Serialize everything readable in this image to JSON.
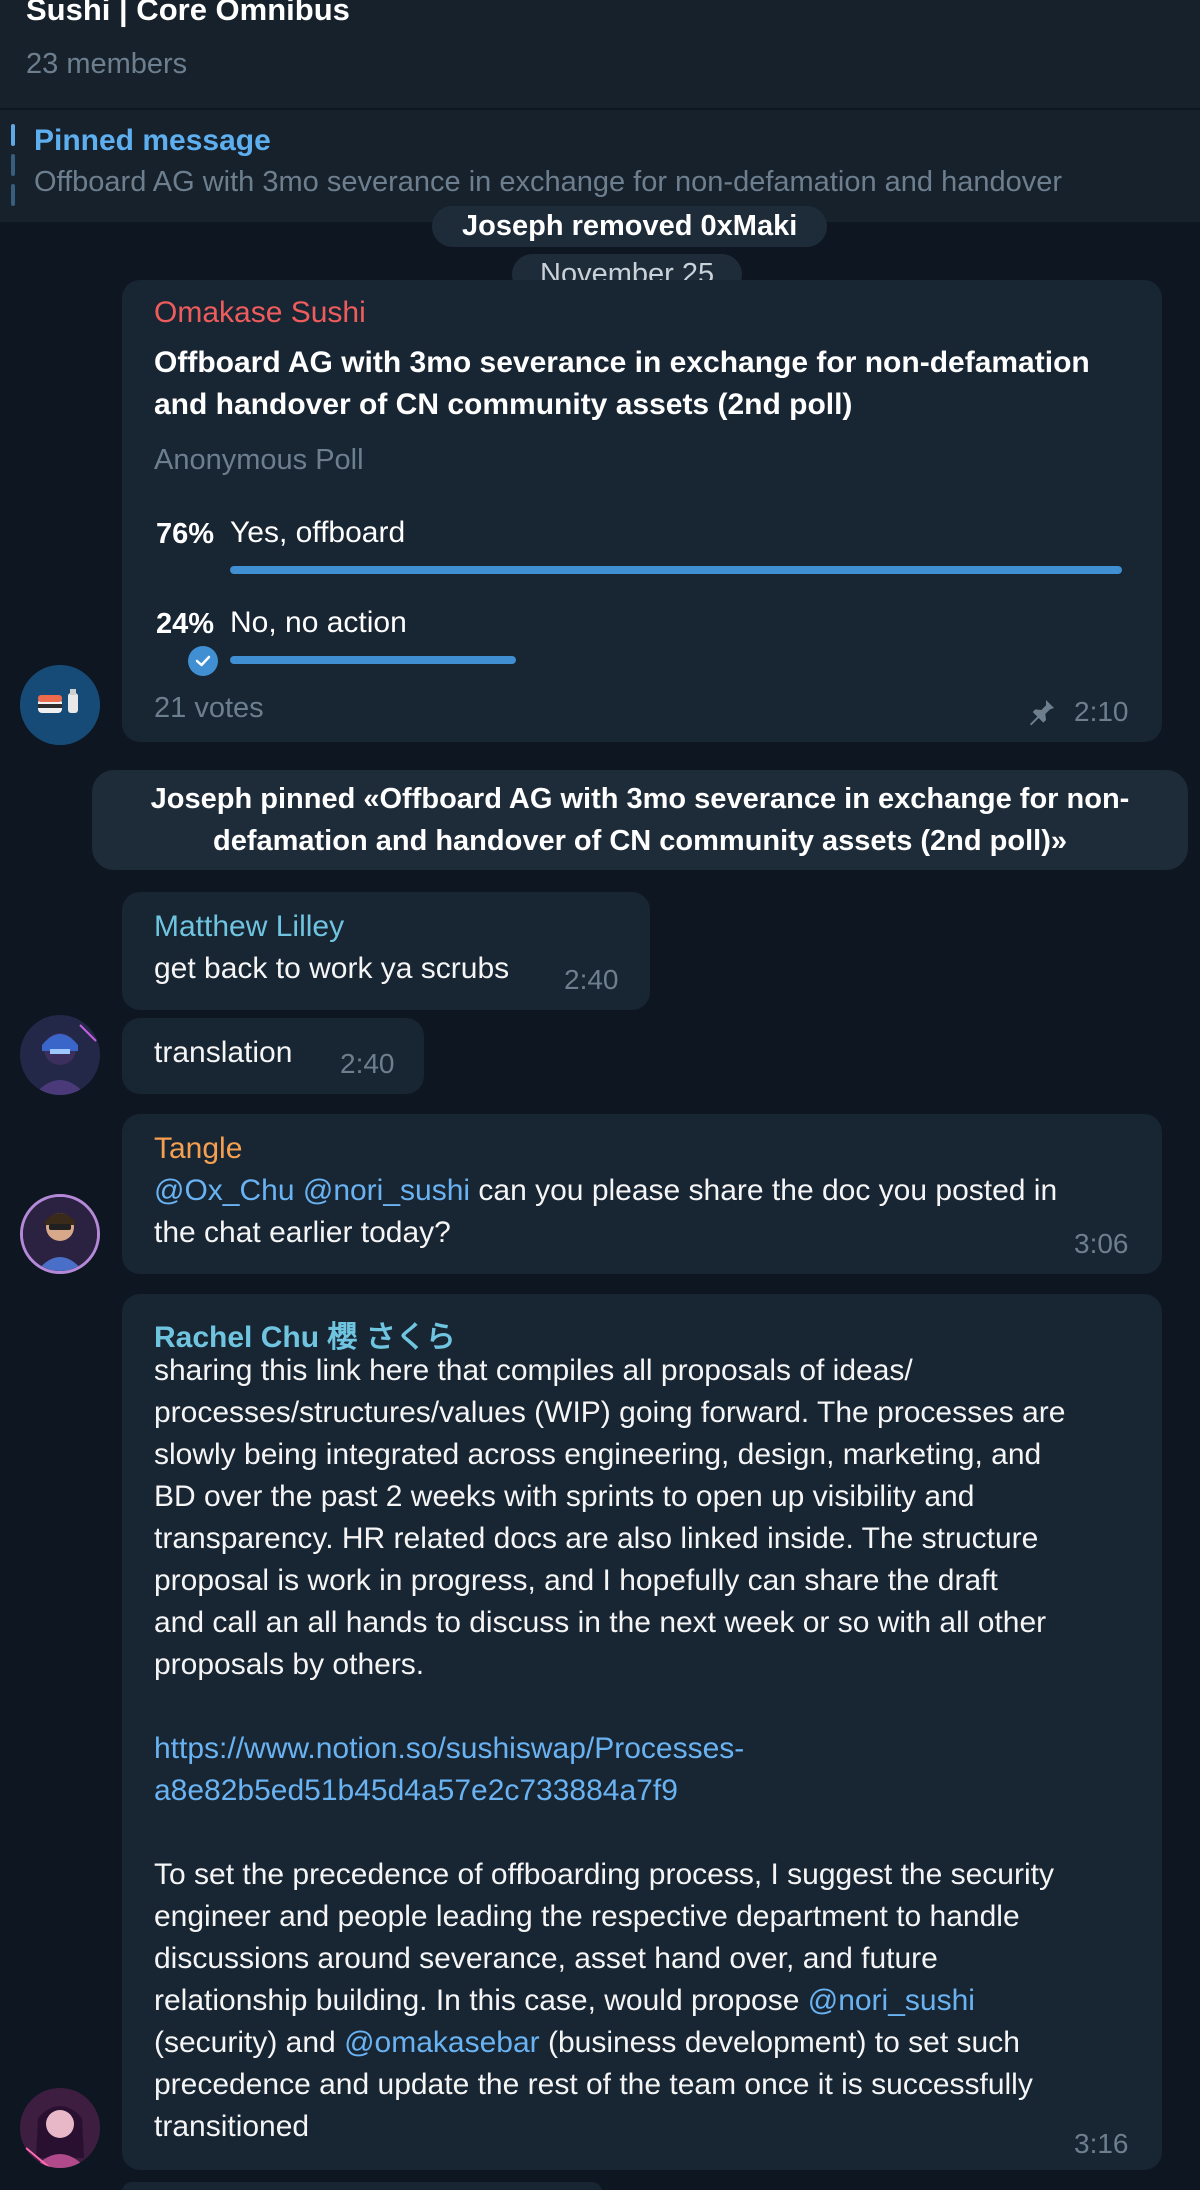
{
  "header": {
    "title": "Sushi | Core Omnibus",
    "members": "23 members"
  },
  "pinned": {
    "title": "Pinned message",
    "text": "Offboard AG with 3mo severance in exchange for non-defamation and handover"
  },
  "service_removed": "Joseph removed 0xMaki",
  "date_separator": "November 25",
  "poll_message": {
    "sender": "Omakase Sushi",
    "question_line1": "Offboard AG with 3mo severance in exchange for non-defamation",
    "question_line2": "and handover of CN community assets (2nd poll)",
    "poll_type": "Anonymous Poll",
    "options": [
      {
        "percent": "76%",
        "label": "Yes, offboard",
        "fraction": 0.76
      },
      {
        "percent": "24%",
        "label": "No, no action",
        "fraction": 0.24
      }
    ],
    "votes": "21 votes",
    "time": "2:10"
  },
  "service_pinned": {
    "line1": "Joseph pinned «Offboard AG with 3mo severance in exchange for non-",
    "line2": "defamation and handover of CN community assets (2nd poll)»"
  },
  "messages": [
    {
      "sender": "Matthew Lilley",
      "text": "get back to work ya scrubs",
      "time": "2:40"
    },
    {
      "text": "translation",
      "time": "2:40"
    },
    {
      "sender": "Tangle",
      "mention1": "@Ox_Chu",
      "mention2": "@nori_sushi",
      "text_line1": "can you please share the doc you posted in",
      "text_line2": "the chat earlier today?",
      "time": "3:06"
    }
  ],
  "rachel": {
    "sender": "Rachel Chu 櫻 さくら",
    "para1": [
      "sharing this link here that compiles all proposals of ideas/",
      "processes/structures/values (WIP) going forward. The processes are",
      "slowly being integrated across engineering, design, marketing, and",
      "BD over the past 2 weeks with sprints to open up visibility and",
      "transparency. HR related docs are also linked inside. The structure",
      "proposal is work in progress, and I hopefully can share the draft",
      "and call an all hands to discuss in the next week or so with all other",
      "proposals by others."
    ],
    "link_line1": "https://www.notion.so/sushiswap/Processes-",
    "link_line2": "a8e82b5ed51b45d4a57e2c733884a7f9",
    "para2": [
      "To set the precedence of offboarding process, I suggest the security",
      "engineer and people leading the respective department to handle",
      "discussions around severance, asset hand over, and future"
    ],
    "p2_line4_pre": "relationship building. In this case, would propose ",
    "p2_line4_mention": "@nori_sushi",
    "p2_line5_pre": "(security) and ",
    "p2_line5_mention": "@omakasebar",
    "p2_line5_post": " (business development) to set such",
    "p2_line6": "precedence and update the rest of the team once it is successfully",
    "p2_line7": "transitioned",
    "time": "3:16"
  },
  "colors": {
    "omakase_name": "#ee5c5c",
    "matthew_name": "#6fc5e0",
    "tangle_name": "#f5a050",
    "rachel_name": "#6fc5e0",
    "link": "#6ab3f3",
    "poll_bar": "#3f8fd2"
  }
}
